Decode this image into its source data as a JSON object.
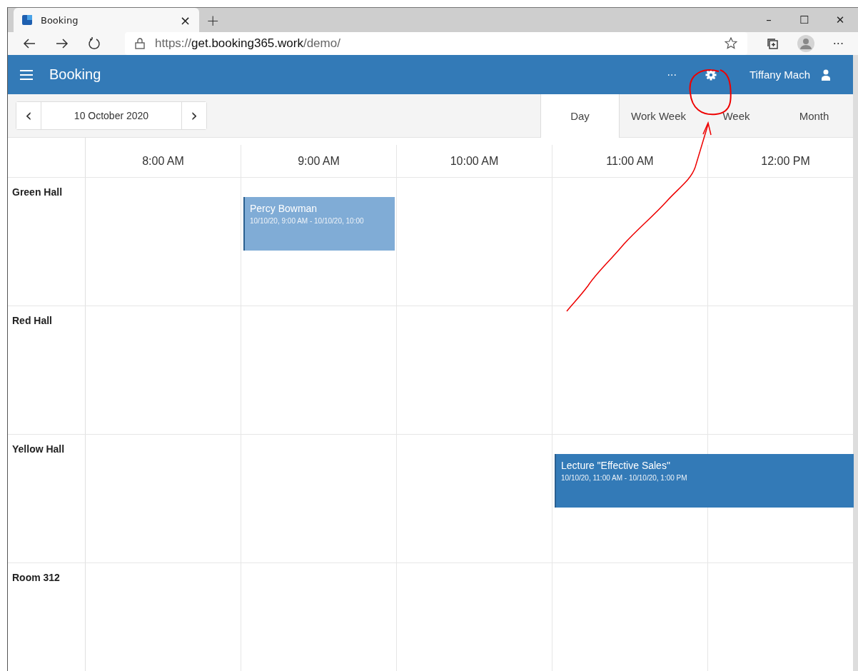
{
  "browser": {
    "tab_title": "Booking",
    "tab_close": "×",
    "new_tab": "+",
    "url_scheme": "https://",
    "url_host": "get.booking365.work",
    "url_path": "/demo/",
    "window_controls": [
      "–",
      "☐",
      "✕"
    ],
    "menu": "···"
  },
  "app": {
    "title": "Booking",
    "more": "···",
    "user": "Tiffany Mach"
  },
  "date_nav": {
    "prev": "‹",
    "date": "10 October 2020",
    "next": "›"
  },
  "views": [
    {
      "label": "Day",
      "selected": true
    },
    {
      "label": "Work Week",
      "selected": false
    },
    {
      "label": "Week",
      "selected": false
    },
    {
      "label": "Month",
      "selected": false
    }
  ],
  "times": [
    "8:00 AM",
    "9:00 AM",
    "10:00 AM",
    "11:00 AM",
    "12:00 PM"
  ],
  "rows": [
    {
      "name": "Green Hall",
      "cells": [
        {},
        {
          "event": {
            "title": "Percy Bowman",
            "time": "10/10/20, 9:00 AM - 10/10/20, 10:00",
            "color": "#80acd6",
            "spans_next": false
          }
        },
        {},
        {},
        {}
      ]
    },
    {
      "name": "Red Hall",
      "cells": [
        {},
        {},
        {},
        {},
        {}
      ]
    },
    {
      "name": "Yellow Hall",
      "cells": [
        {},
        {},
        {},
        {
          "event": {
            "title": "Lecture \"Effective Sales\"",
            "time": "10/10/20, 11:00 AM - 10/10/20, 1:00 PM",
            "color": "#337ab7",
            "spans_next": true
          }
        },
        {}
      ]
    },
    {
      "name": "Room 312",
      "cells": [
        {},
        {},
        {},
        {},
        {}
      ]
    }
  ]
}
